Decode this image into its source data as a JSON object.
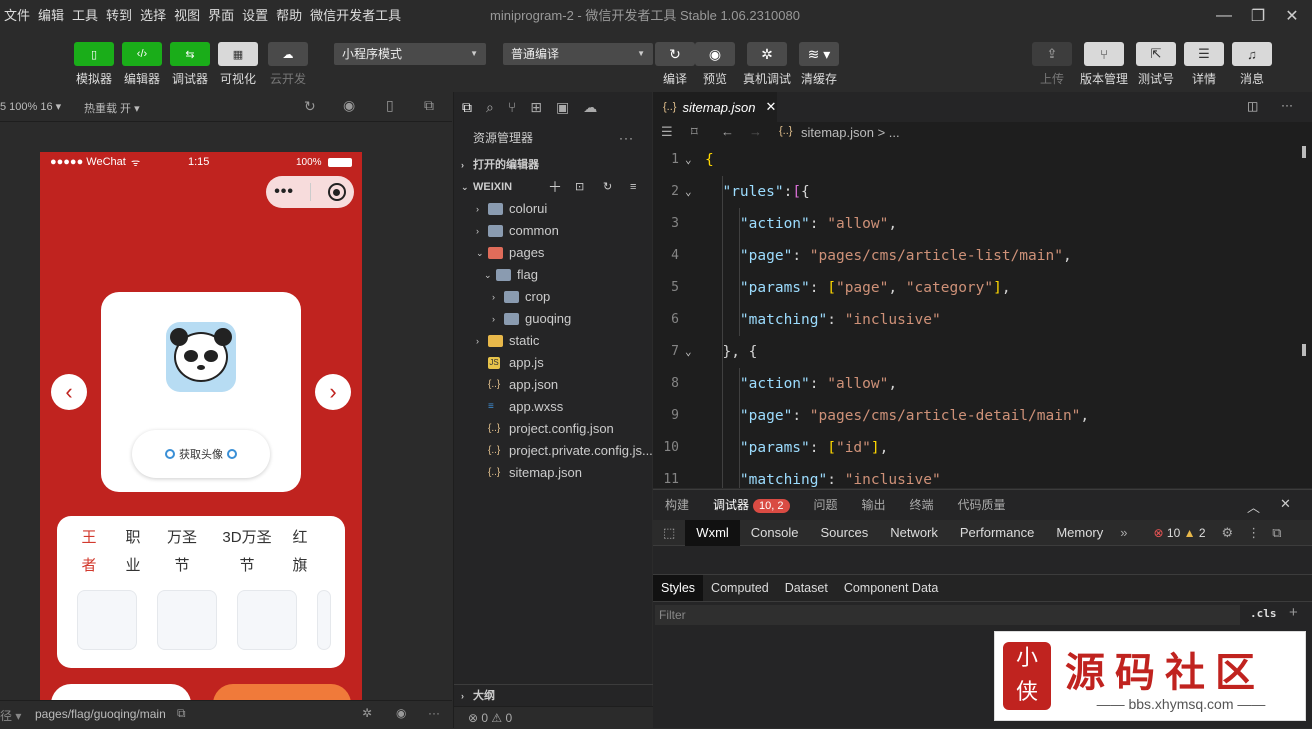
{
  "menubar": {
    "items": [
      "文件",
      "编辑",
      "工具",
      "转到",
      "选择",
      "视图",
      "界面",
      "设置",
      "帮助",
      "微信开发者工具"
    ],
    "window_title": "miniprogram-2 - 微信开发者工具 Stable 1.06.2310080"
  },
  "toolbar": {
    "left_buttons": [
      {
        "label": "模拟器",
        "icon": "phone-icon"
      },
      {
        "label": "编辑器",
        "icon": "code-icon"
      },
      {
        "label": "调试器",
        "icon": "debug-icon"
      },
      {
        "label": "可视化",
        "icon": "layout-icon"
      },
      {
        "label": "云开发",
        "icon": "cloud-icon"
      }
    ],
    "mode_select": "小程序模式",
    "compile_select": "普通编译",
    "mid_buttons": [
      {
        "label": "编译",
        "icon": "refresh-icon"
      },
      {
        "label": "预览",
        "icon": "eye-icon"
      },
      {
        "label": "真机调试",
        "icon": "bug-icon"
      },
      {
        "label": "清缓存",
        "icon": "layers-icon"
      }
    ],
    "right_buttons": [
      {
        "label": "上传",
        "icon": "upload-icon"
      },
      {
        "label": "版本管理",
        "icon": "branch-icon"
      },
      {
        "label": "测试号",
        "icon": "external-icon"
      },
      {
        "label": "详情",
        "icon": "menu-icon"
      },
      {
        "label": "消息",
        "icon": "bell-icon"
      }
    ]
  },
  "simulator": {
    "device_zoom": "5 100% 16 ▾",
    "hot_reload": "热重载 开 ▾",
    "status_carrier": "●●●●● WeChat",
    "status_time": "1:15",
    "status_battery": "100%",
    "avatar_button": "获取头像",
    "categories": [
      {
        "line1": "王",
        "line2": "者",
        "active": true
      },
      {
        "line1": "职",
        "line2": "业",
        "active": false
      },
      {
        "line1": "万圣",
        "line2": "节",
        "active": false
      },
      {
        "line1": "3D万圣",
        "line2": "节",
        "active": false
      },
      {
        "line1": "红",
        "line2": "旗",
        "active": false
      }
    ],
    "page_path": "pages/flag/guoqing/main"
  },
  "explorer": {
    "title": "资源管理器",
    "open_editors": "打开的编辑器",
    "root": "WEIXIN",
    "tree": [
      {
        "name": "colorui",
        "type": "folder",
        "depth": 1,
        "chevron": "›"
      },
      {
        "name": "common",
        "type": "folder",
        "depth": 1,
        "chevron": "›"
      },
      {
        "name": "pages",
        "type": "folder-special",
        "depth": 1,
        "chevron": "⌄"
      },
      {
        "name": "flag",
        "type": "folder-open",
        "depth": 2,
        "chevron": "⌄"
      },
      {
        "name": "crop",
        "type": "folder",
        "depth": 3,
        "chevron": "›"
      },
      {
        "name": "guoqing",
        "type": "folder",
        "depth": 3,
        "chevron": "›"
      },
      {
        "name": "static",
        "type": "folder-yellow",
        "depth": 1,
        "chevron": "›"
      },
      {
        "name": "app.js",
        "type": "js",
        "depth": 1,
        "chevron": ""
      },
      {
        "name": "app.json",
        "type": "json",
        "depth": 1,
        "chevron": ""
      },
      {
        "name": "app.wxss",
        "type": "css",
        "depth": 1,
        "chevron": ""
      },
      {
        "name": "project.config.json",
        "type": "json",
        "depth": 1,
        "chevron": ""
      },
      {
        "name": "project.private.config.js...",
        "type": "json",
        "depth": 1,
        "chevron": ""
      },
      {
        "name": "sitemap.json",
        "type": "json",
        "depth": 1,
        "chevron": ""
      }
    ],
    "outline": "大纲",
    "status": "⊗ 0 ⚠ 0"
  },
  "editor": {
    "tab": "sitemap.json",
    "breadcrumb": "sitemap.json > ...",
    "code_lines": [
      {
        "n": "1",
        "fold": "⌄",
        "tokens": [
          [
            "b1",
            "{"
          ]
        ]
      },
      {
        "n": "2",
        "fold": "⌄",
        "tokens": [
          [
            "p",
            "  "
          ],
          [
            "k",
            "\"rules\""
          ],
          [
            "p",
            ":"
          ],
          [
            "b2",
            "["
          ],
          [
            "p",
            "{"
          ]
        ]
      },
      {
        "n": "3",
        "fold": "",
        "tokens": [
          [
            "p",
            "    "
          ],
          [
            "k",
            "\"action\""
          ],
          [
            "p",
            ": "
          ],
          [
            "s",
            "\"allow\""
          ],
          [
            "p",
            ","
          ]
        ]
      },
      {
        "n": "4",
        "fold": "",
        "tokens": [
          [
            "p",
            "    "
          ],
          [
            "k",
            "\"page\""
          ],
          [
            "p",
            ": "
          ],
          [
            "s",
            "\"pages/cms/article-list/main\""
          ],
          [
            "p",
            ","
          ]
        ]
      },
      {
        "n": "5",
        "fold": "",
        "tokens": [
          [
            "p",
            "    "
          ],
          [
            "k",
            "\"params\""
          ],
          [
            "p",
            ": "
          ],
          [
            "b1",
            "["
          ],
          [
            "s",
            "\"page\""
          ],
          [
            "p",
            ", "
          ],
          [
            "s",
            "\"category\""
          ],
          [
            "b1",
            "]"
          ],
          [
            "p",
            ","
          ]
        ]
      },
      {
        "n": "6",
        "fold": "",
        "tokens": [
          [
            "p",
            "    "
          ],
          [
            "k",
            "\"matching\""
          ],
          [
            "p",
            ": "
          ],
          [
            "s",
            "\"inclusive\""
          ]
        ]
      },
      {
        "n": "7",
        "fold": "⌄",
        "tokens": [
          [
            "p",
            "  }, {"
          ]
        ]
      },
      {
        "n": "8",
        "fold": "",
        "tokens": [
          [
            "p",
            "    "
          ],
          [
            "k",
            "\"action\""
          ],
          [
            "p",
            ": "
          ],
          [
            "s",
            "\"allow\""
          ],
          [
            "p",
            ","
          ]
        ]
      },
      {
        "n": "9",
        "fold": "",
        "tokens": [
          [
            "p",
            "    "
          ],
          [
            "k",
            "\"page\""
          ],
          [
            "p",
            ": "
          ],
          [
            "s",
            "\"pages/cms/article-detail/main\""
          ],
          [
            "p",
            ","
          ]
        ]
      },
      {
        "n": "10",
        "fold": "",
        "tokens": [
          [
            "p",
            "    "
          ],
          [
            "k",
            "\"params\""
          ],
          [
            "p",
            ": "
          ],
          [
            "b1",
            "["
          ],
          [
            "s",
            "\"id\""
          ],
          [
            "b1",
            "]"
          ],
          [
            "p",
            ","
          ]
        ]
      },
      {
        "n": "11",
        "fold": "",
        "tokens": [
          [
            "p",
            "    "
          ],
          [
            "k",
            "\"matching\""
          ],
          [
            "p",
            ": "
          ],
          [
            "s",
            "\"inclusive\""
          ]
        ]
      }
    ]
  },
  "debugger": {
    "tabs": [
      "构建",
      "调试器",
      "问题",
      "输出",
      "终端",
      "代码质量"
    ],
    "active_tab": "调试器",
    "badge": "10, 2",
    "dev_tabs": [
      "Wxml",
      "Console",
      "Sources",
      "Network",
      "Performance",
      "Memory"
    ],
    "errors": "10",
    "warnings": "2",
    "styles_tabs": [
      "Styles",
      "Computed",
      "Dataset",
      "Component Data"
    ],
    "filter_placeholder": "Filter",
    "cls": ".cls",
    "plus": "+"
  },
  "watermark": {
    "text": "源码社区",
    "url": "bbs.xhymsq.com"
  },
  "colors": {
    "accent_green": "#1aad19",
    "phone_red": "#c0231f",
    "editor_bg": "#1e1e1e",
    "badge_red": "#d94b43"
  }
}
